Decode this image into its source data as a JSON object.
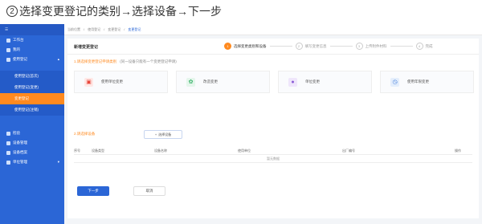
{
  "caption": {
    "num": "2",
    "text": "选择变更登记的类别→选择设备→下一步"
  },
  "sidebar": {
    "top_icon": "menu-icon",
    "items": [
      {
        "label": "工作台"
      },
      {
        "label": "我的"
      },
      {
        "label": "使用登记"
      }
    ],
    "subitems": [
      {
        "label": "使用登记(首次)"
      },
      {
        "label": "使用登记(变更)"
      },
      {
        "label": "变更登记"
      },
      {
        "label": "使用登记(注销)"
      }
    ],
    "bottom_items": [
      {
        "label": "检验"
      },
      {
        "label": "设备管理"
      },
      {
        "label": "设备档案"
      },
      {
        "label": "单位管理"
      }
    ]
  },
  "breadcrumb": {
    "items": [
      "当前位置",
      "使用登记",
      "变更登记"
    ],
    "current": "变更登记"
  },
  "card": {
    "title": "新增变更登记"
  },
  "steps": [
    {
      "num": "1",
      "label": "选择变更类别和设备"
    },
    {
      "num": "2",
      "label": "填写变更信息"
    },
    {
      "num": "3",
      "label": "上传附件材料"
    },
    {
      "num": "4",
      "label": "完成"
    }
  ],
  "section1": {
    "label": "1.请选择变更登记申请类别",
    "hint": "(同一设备只能有一个变更登记申请)"
  },
  "types": [
    {
      "label": "使用单位变更",
      "color": "#e8463a",
      "bg": "#ffe8e6"
    },
    {
      "label": "改造变更",
      "color": "#3bb36b",
      "bg": "#e5f6ec"
    },
    {
      "label": "单位变更",
      "color": "#8a5bd6",
      "bg": "#efe6fb"
    },
    {
      "label": "使用年限变更",
      "color": "#3b78d8",
      "bg": "#e4eefc"
    }
  ],
  "section2": {
    "label": "2.请选择设备"
  },
  "add_button": {
    "label": "选择设备"
  },
  "table": {
    "headers": [
      "序号",
      "设备类型",
      "设备名称",
      "使用单位",
      "出厂编号",
      "操作"
    ],
    "empty_text": "暂无数据"
  },
  "actions": {
    "next": "下一步",
    "cancel": "取消"
  }
}
